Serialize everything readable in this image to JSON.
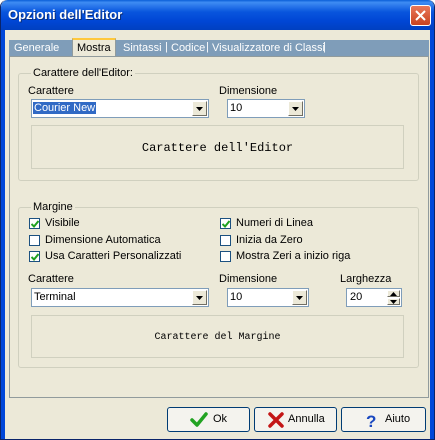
{
  "window": {
    "title": "Opzioni dell'Editor"
  },
  "tabs": [
    {
      "label": "Generale"
    },
    {
      "label": "Mostra"
    },
    {
      "label": "Sintassi"
    },
    {
      "label": "Codice"
    },
    {
      "label": "Visualizzatore di Classi"
    }
  ],
  "tab_separator": "|",
  "editor_font": {
    "group_label": "Carattere dell'Editor:",
    "font_label": "Carattere",
    "font_value": "Courier New",
    "size_label": "Dimensione",
    "size_value": "10",
    "preview_text": "Carattere dell'Editor"
  },
  "margin": {
    "group_label": "Margine",
    "checkboxes": [
      {
        "label": "Visibile",
        "checked": true
      },
      {
        "label": "Numeri di Linea",
        "checked": true
      },
      {
        "label": "Dimensione Automatica",
        "checked": false
      },
      {
        "label": "Inizia da Zero",
        "checked": false
      },
      {
        "label": "Usa Caratteri Personalizzati",
        "checked": true
      },
      {
        "label": "Mostra Zeri a inizio riga",
        "checked": false
      }
    ],
    "font_label": "Carattere",
    "font_value": "Terminal",
    "size_label": "Dimensione",
    "size_value": "10",
    "width_label": "Larghezza",
    "width_value": "20",
    "preview_text": "Carattere del Margine"
  },
  "buttons": {
    "ok": "Ok",
    "cancel": "Annulla",
    "help": "Aiuto"
  },
  "icons": {
    "close": "close-icon",
    "ok": "checkmark-icon",
    "cancel": "x-cross-icon",
    "help": "question-mark-icon"
  }
}
